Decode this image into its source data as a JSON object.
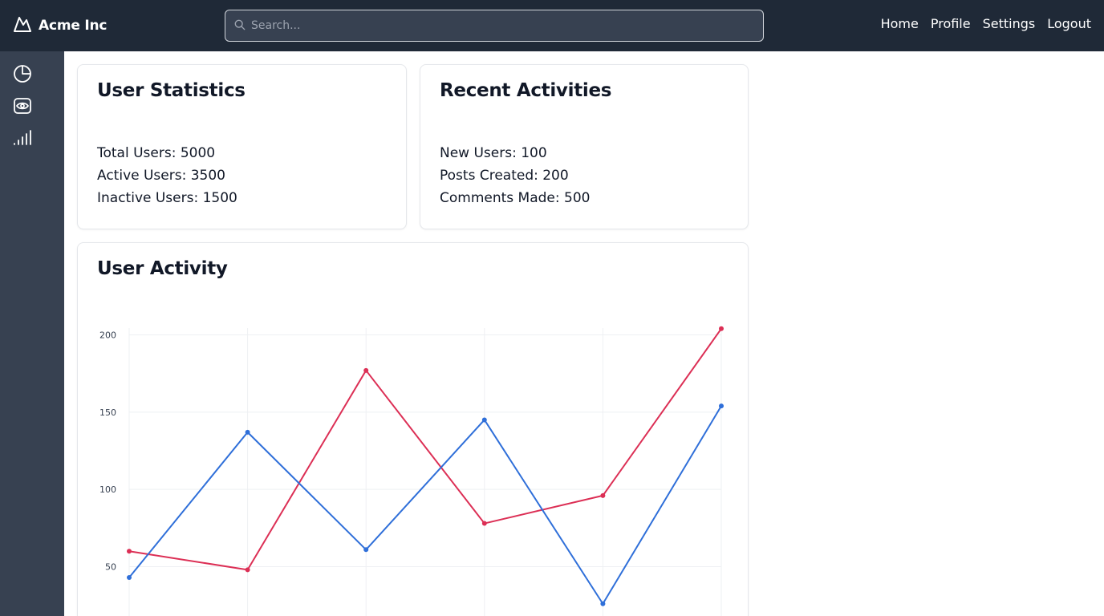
{
  "header": {
    "brand": "Acme Inc",
    "search_placeholder": "Search...",
    "nav": [
      "Home",
      "Profile",
      "Settings",
      "Logout"
    ]
  },
  "sidebar": {
    "icons": [
      "pie-chart-icon",
      "eye-icon",
      "signal-bars-icon"
    ]
  },
  "cards": {
    "user_statistics": {
      "title": "User Statistics",
      "lines": [
        "Total Users: 5000",
        "Active Users: 3500",
        "Inactive Users: 1500"
      ]
    },
    "recent_activities": {
      "title": "Recent Activities",
      "lines": [
        "New Users: 100",
        "Posts Created: 200",
        "Comments Made: 500"
      ]
    },
    "user_activity": {
      "title": "User Activity"
    }
  },
  "colors": {
    "topbar": "#1f2937",
    "sidebar": "#374151",
    "series_red": "#dc2f55",
    "series_blue": "#2f6fd9"
  },
  "chart_data": {
    "type": "line",
    "title": "User Activity",
    "xlabel": "",
    "ylabel": "",
    "x": [
      0,
      1,
      2,
      3,
      4,
      5
    ],
    "yticks": [
      50,
      100,
      150,
      200
    ],
    "ylim": [
      30,
      204
    ],
    "grid": true,
    "series": [
      {
        "color": "#dc2f55",
        "values": [
          60,
          48,
          177,
          78,
          96,
          204
        ]
      },
      {
        "color": "#2f6fd9",
        "values": [
          43,
          137,
          61,
          145,
          26,
          154
        ]
      }
    ]
  }
}
